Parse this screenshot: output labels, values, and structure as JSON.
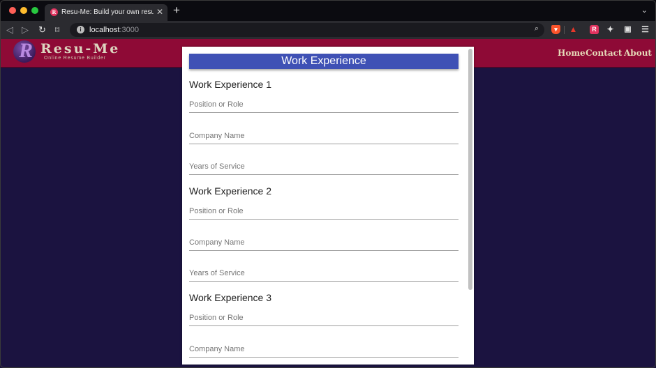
{
  "browser": {
    "tab_title": "Resu-Me: Build your own resume",
    "tab_favicon_letter": "R",
    "url_host": "localhost",
    "url_port": ":3000"
  },
  "site": {
    "logo_letter": "R",
    "logo_name": "Resu-Me",
    "logo_tagline": "Online Resume Builder",
    "nav": {
      "home": "Home",
      "contact": "Contact",
      "about": "About"
    }
  },
  "form": {
    "section_title": "Work Experience",
    "groups": [
      {
        "title": "Work Experience 1",
        "fields": [
          "Position or Role",
          "Company Name",
          "Years of Service"
        ]
      },
      {
        "title": "Work Experience 2",
        "fields": [
          "Position or Role",
          "Company Name",
          "Years of Service"
        ]
      },
      {
        "title": "Work Experience 3",
        "fields": [
          "Position or Role",
          "Company Name"
        ]
      }
    ]
  },
  "colors": {
    "header": "#8e0a36",
    "page_bg": "#1b1340",
    "banner": "#3f51b5"
  }
}
